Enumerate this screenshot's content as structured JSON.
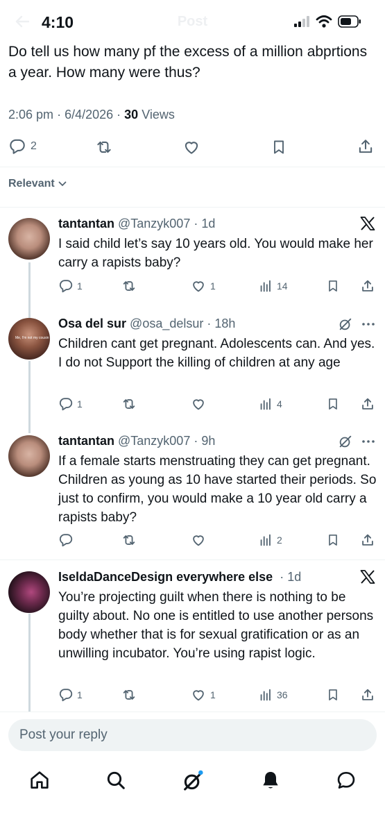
{
  "status_bar": {
    "time": "4:10",
    "ghost_title": "Post"
  },
  "post": {
    "text": "Do tell us how many pf the excess of a million abprtions a year. How many were thus?",
    "time": "2:06 pm",
    "date": "6/4/2026",
    "views_count": "30",
    "views_label": "Views",
    "reply_count": "2"
  },
  "sort": {
    "label": "Relevant"
  },
  "replies": [
    {
      "name": "tantantan",
      "handle": "@Tanzyk007",
      "time": "1d",
      "text": "I said child let’s say 10 years old. You would make her carry a rapists baby?",
      "replies": "1",
      "reposts": "",
      "likes": "1",
      "views": "14",
      "corner_icon": "x-logo-icon"
    },
    {
      "name": "Osa del sur",
      "handle": "@osa_delsur",
      "time": "18h",
      "text": "Children cant get pregnant. Adolescents can. And yes. I do not Support the killing of children at any age",
      "replies": "1",
      "reposts": "",
      "likes": "",
      "views": "4",
      "corner_icon": "grok-icon",
      "avatar_caption": "Me, I'm not my cousin"
    },
    {
      "name": "tantantan",
      "handle": "@Tanzyk007",
      "time": "9h",
      "text": "If a female starts menstruating they can get pregnant. Children as young as 10 have started their periods. So just to confirm, you would make a 10 year old carry a rapists baby?",
      "replies": "",
      "reposts": "",
      "likes": "",
      "views": "2",
      "corner_icon": "grok-icon"
    },
    {
      "name": "IseldaDanceDesign everywhere else",
      "handle": "",
      "time": "1d",
      "text": "You’re projecting guilt when there is nothing to be guilty about. No one is entitled to use another persons body whether that is for sexual gratification or as an unwilling incubator. You’re using rapist logic.",
      "replies": "1",
      "reposts": "",
      "likes": "1",
      "views": "36",
      "corner_icon": "x-logo-icon"
    }
  ],
  "composer": {
    "placeholder": "Post your reply"
  },
  "nav": [
    "home-icon",
    "search-icon",
    "grok-icon",
    "notifications-icon",
    "messages-icon"
  ],
  "colors": {
    "text": "#0f1419",
    "secondary": "#536471",
    "accent": "#1d9bf0",
    "divider": "#eff3f4",
    "thread": "#cfd9de"
  }
}
